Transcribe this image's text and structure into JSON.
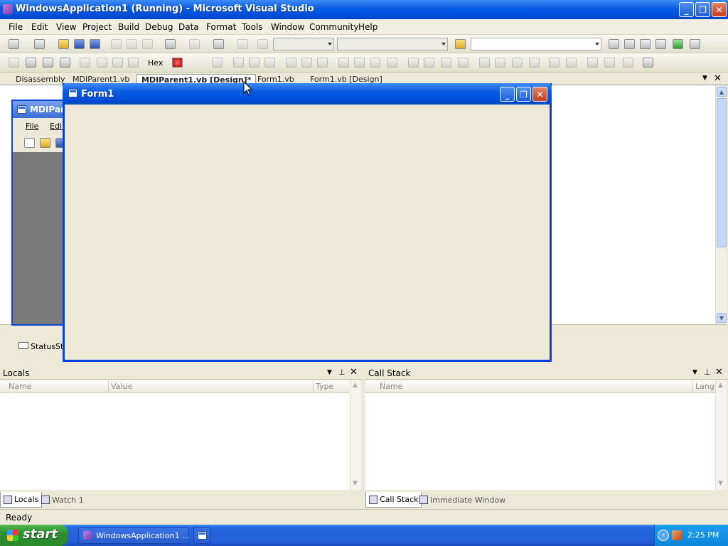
{
  "window": {
    "title": "WindowsApplication1 (Running) - Microsoft Visual Studio",
    "minimize_glyph": "_",
    "restore_glyph": "❐",
    "close_glyph": "✕"
  },
  "menu": [
    "File",
    "Edit",
    "View",
    "Project",
    "Build",
    "Debug",
    "Data",
    "Format",
    "Tools",
    "Window",
    "Community",
    "Help"
  ],
  "toolbar": {
    "hex_label": "Hex"
  },
  "tabs": [
    {
      "label": "Disassembly",
      "active": false
    },
    {
      "label": "MDIParent1.vb",
      "active": false
    },
    {
      "label": "MDIParent1.vb [Design]*",
      "active": true
    },
    {
      "label": "Form1.vb",
      "active": false
    },
    {
      "label": "Form1.vb [Design]",
      "active": false
    }
  ],
  "designer": {
    "mdi_title": "MDIParen",
    "mdi_menu": [
      "File",
      "Edit"
    ],
    "status_component": "StatusStr"
  },
  "form1": {
    "title": "Form1"
  },
  "locals": {
    "title": "Locals",
    "columns": [
      "Name",
      "Value",
      "Type"
    ]
  },
  "callstack": {
    "title": "Call Stack",
    "columns": [
      "Name",
      "Langu"
    ]
  },
  "bottom_tabs_left": [
    "Locals",
    "Watch 1"
  ],
  "bottom_tabs_right": [
    "Call Stack",
    "Immediate Window"
  ],
  "status": {
    "text": "Ready"
  },
  "taskbar": {
    "start_label": "start",
    "task_label": "WindowsApplication1 ...",
    "clock": "2:25 PM"
  }
}
